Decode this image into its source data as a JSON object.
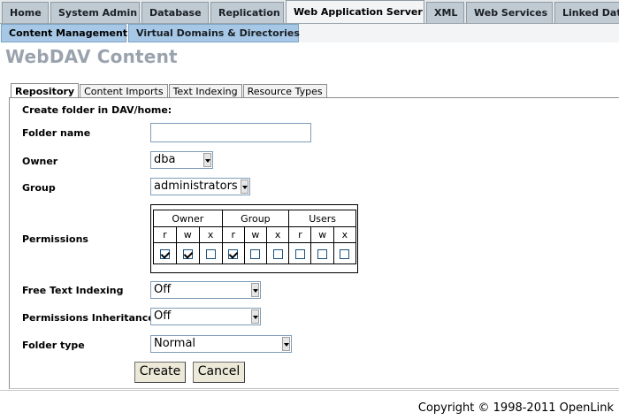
{
  "nav": {
    "primary": [
      {
        "label": "Home",
        "active": false
      },
      {
        "label": "System Admin",
        "active": false
      },
      {
        "label": "Database",
        "active": false
      },
      {
        "label": "Replication",
        "active": false
      },
      {
        "label": "Web Application Server",
        "active": true
      },
      {
        "label": "XML",
        "active": false
      },
      {
        "label": "Web Services",
        "active": false
      },
      {
        "label": "Linked Data",
        "active": false
      }
    ],
    "secondary": [
      {
        "label": "Content Management",
        "active": true
      },
      {
        "label": "Virtual Domains & Directories",
        "active": false
      }
    ]
  },
  "page": {
    "title": "WebDAV Content",
    "tabs": [
      "Repository",
      "Content Imports",
      "Text Indexing",
      "Resource Types"
    ],
    "active_tab": "Repository"
  },
  "form": {
    "heading": "Create folder in DAV/home:",
    "folder_name": {
      "label": "Folder name",
      "value": ""
    },
    "owner": {
      "label": "Owner",
      "value": "dba"
    },
    "group": {
      "label": "Group",
      "value": "administrators"
    },
    "permissions": {
      "label": "Permissions",
      "groups": [
        "Owner",
        "Group",
        "Users"
      ],
      "flags": [
        "r",
        "w",
        "x"
      ],
      "checked": [
        true,
        true,
        false,
        true,
        false,
        false,
        false,
        false,
        false
      ]
    },
    "free_text_indexing": {
      "label": "Free Text Indexing",
      "value": "Off"
    },
    "permissions_inheritance": {
      "label": "Permissions Inheritance",
      "value": "Off"
    },
    "folder_type": {
      "label": "Folder type",
      "value": "Normal"
    },
    "create_label": "Create",
    "cancel_label": "Cancel"
  },
  "footer": {
    "copyright": "Copyright © 1998-2011 OpenLink"
  },
  "colors": {
    "primary_tab": "#bfcad3",
    "secondary_tab": "#a6c8e6",
    "title": "#9aa3ad"
  }
}
